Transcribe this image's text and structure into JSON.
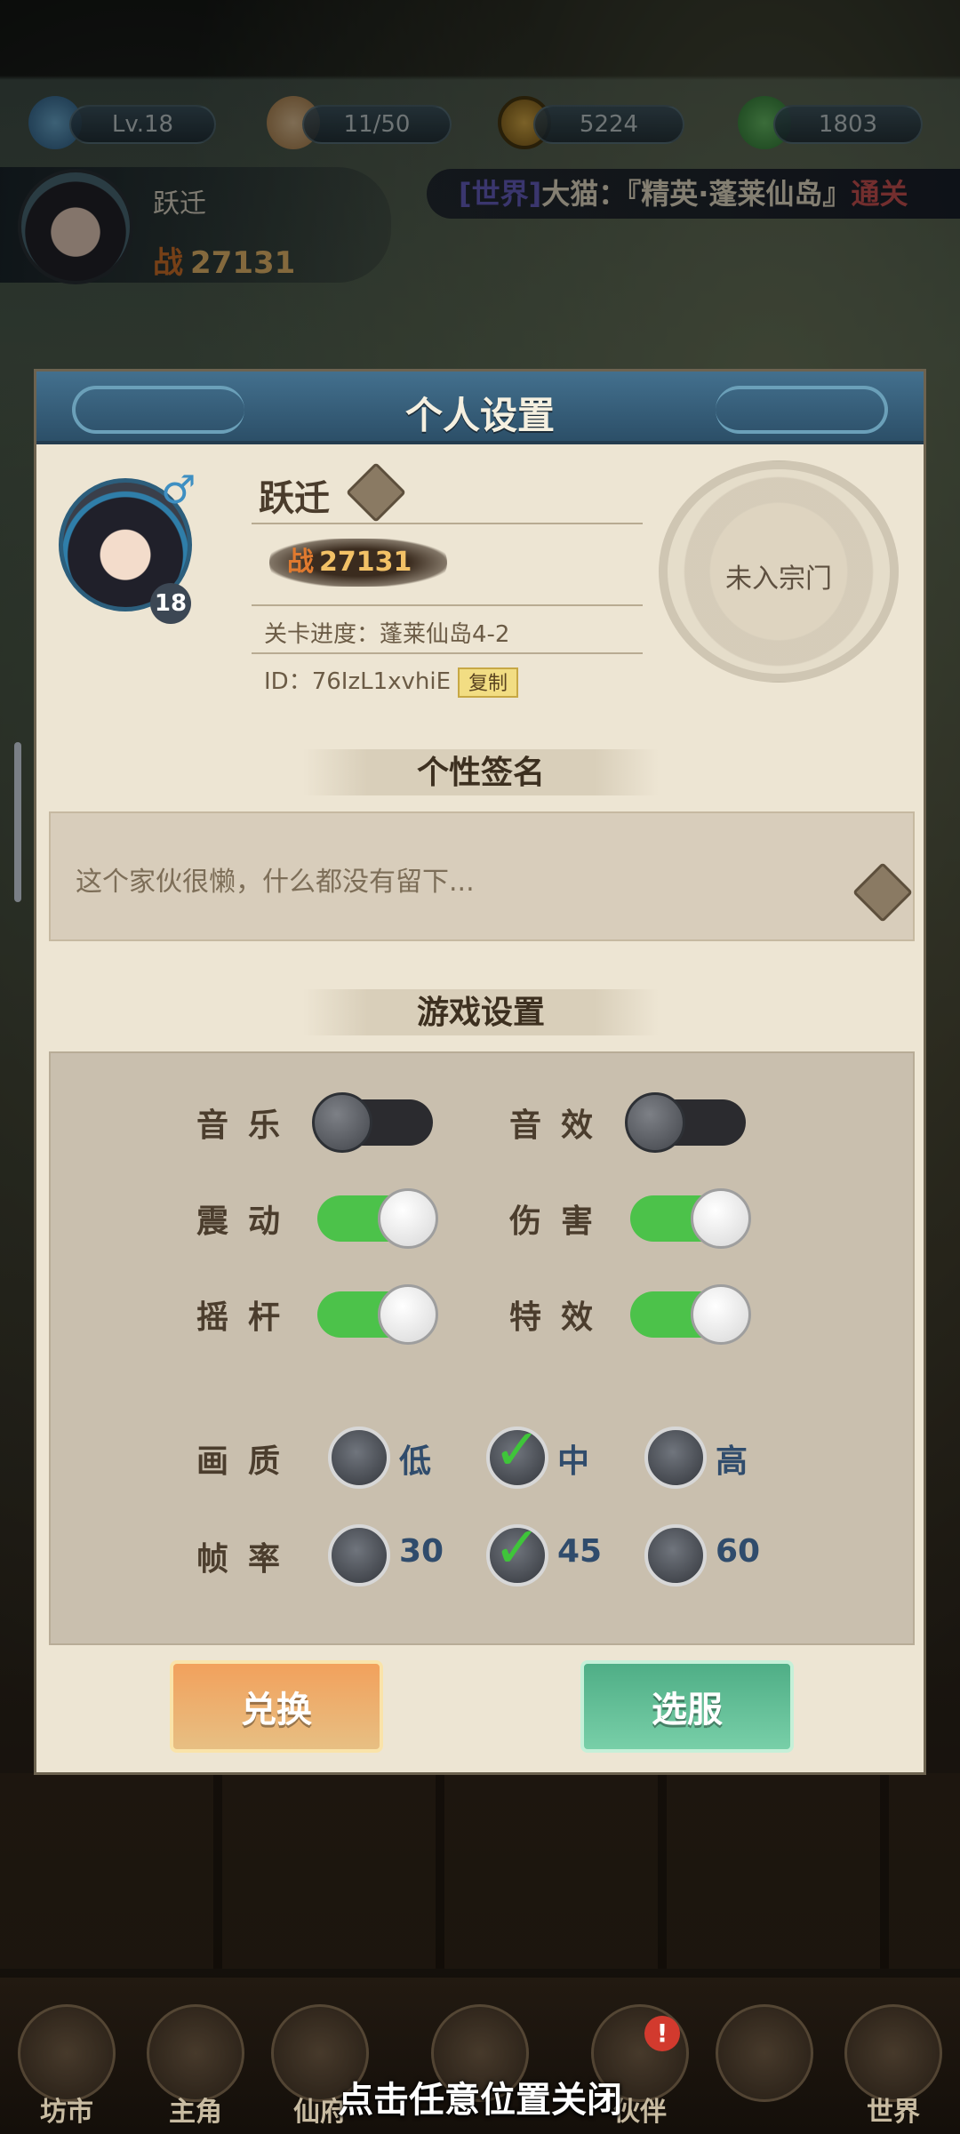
{
  "hud": {
    "level": "Lv.18",
    "stamina": "11/50",
    "gold": "5224",
    "jade": "1803"
  },
  "player": {
    "name": "跃迁",
    "power_glyph": "战",
    "power": "27131"
  },
  "chat": {
    "tag": "[世界]",
    "text": "大猫：『精英·蓬莱仙岛』",
    "extra": "通关"
  },
  "dialog": {
    "title": "个人设置",
    "name": "跃迁",
    "level_badge": "18",
    "power_glyph": "战",
    "power": "27131",
    "progress": "关卡进度：蓬莱仙岛4-2",
    "id_text": "ID：76IzL1xvhiE",
    "copy_label": "复制",
    "sect_text": "未入宗门",
    "signature_title": "个性签名",
    "signature_text": "这个家伙很懒，什么都没有留下...",
    "game_settings_title": "游戏设置",
    "toggles": {
      "music": {
        "label": "音乐",
        "on": false
      },
      "sfx": {
        "label": "音效",
        "on": false
      },
      "vibration": {
        "label": "震动",
        "on": true
      },
      "damage": {
        "label": "伤害",
        "on": true
      },
      "joystick": {
        "label": "摇杆",
        "on": true
      },
      "effects": {
        "label": "特效",
        "on": true
      }
    },
    "quality": {
      "label": "画质",
      "options": [
        "低",
        "中",
        "高"
      ],
      "selected": "中"
    },
    "framerate": {
      "label": "帧率",
      "options": [
        "30",
        "45",
        "60"
      ],
      "selected": "45"
    },
    "redeem_button": "兑换",
    "server_button": "选服"
  },
  "nav": {
    "items": [
      "坊市",
      "主角",
      "仙府",
      "",
      "伙伴",
      "",
      "世界"
    ],
    "badge": "!"
  },
  "close_hint": "点击任意位置关闭",
  "colors": {
    "toggle_on": "#4cc24a",
    "toggle_off": "#2b2b2f",
    "check": "#3fc53a",
    "redeem": "#f2a15c",
    "server": "#4fae86",
    "header": "#43708e"
  }
}
